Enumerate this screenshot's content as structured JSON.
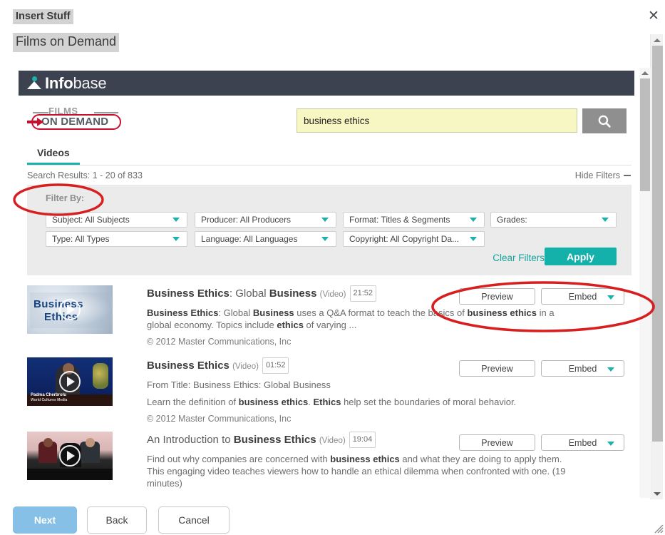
{
  "dialog": {
    "insert_stuff_label": "Insert Stuff",
    "provider_label": "Films on Demand",
    "close_icon": "close-icon"
  },
  "brand": {
    "infobase_bold": "Info",
    "infobase_light": "base",
    "fod_films": "FILMS",
    "fod_ondemand": "ON DEMAND",
    "accent_teal": "#17b3ad",
    "header_dark": "#3c4250",
    "fod_red": "#c8102e"
  },
  "search": {
    "value": "business ethics",
    "placeholder": "Search",
    "button_icon": "search-icon"
  },
  "tabs": [
    {
      "label": "Videos",
      "active": true
    }
  ],
  "results_header": {
    "summary": "Search Results: 1 - 20 of 833",
    "hide_filters": "Hide Filters"
  },
  "filters": {
    "title": "Filter By:",
    "selects": [
      {
        "id": "subject",
        "label": "Subject: All Subjects"
      },
      {
        "id": "producer",
        "label": "Producer: All Producers"
      },
      {
        "id": "format",
        "label": "Format: Titles & Segments"
      },
      {
        "id": "grades",
        "label": "Grades:"
      },
      {
        "id": "type",
        "label": "Type: All Types"
      },
      {
        "id": "language",
        "label": "Language: All Languages"
      },
      {
        "id": "copyright",
        "label": "Copyright: All Copyright Da..."
      }
    ],
    "clear_label": "Clear Filters",
    "apply_label": "Apply"
  },
  "results": [
    {
      "title_html": "<span class=\"b\">Business Ethics</span>: Global <span class=\"b\">Business</span>",
      "media_type": "(Video)",
      "duration": "21:52",
      "from_title": "",
      "description_html": "<b>Business Ethics</b>: Global <b>Business</b> uses a Q&amp;A format to teach the basics of <b>business ethics</b> in a global economy. Topics include <b>ethics</b> of varying ...",
      "copyright": "© 2012 Master Communications, Inc",
      "preview_label": "Preview",
      "embed_label": "Embed",
      "thumb_style": "thumb-1"
    },
    {
      "title_html": "<span class=\"b\">Business Ethics</span>",
      "media_type": "(Video)",
      "duration": "01:52",
      "from_title": "From Title: Business Ethics: Global Business",
      "description_html": "Learn the definition of <b>business ethics</b>. <b>Ethics</b> help set the boundaries of moral behavior.",
      "copyright": "© 2012 Master Communications, Inc",
      "preview_label": "Preview",
      "embed_label": "Embed",
      "thumb_style": "thumb-2",
      "thumb_caption_line1": "Padma Cherbrolu",
      "thumb_caption_line2": "World Cultures Media"
    },
    {
      "title_html": "An Introduction to <span class=\"b\">Business Ethics</span>",
      "media_type": "(Video)",
      "duration": "19:04",
      "from_title": "",
      "description_html": "Find out why companies are concerned with <b>business ethics</b> and what they are doing to apply them. This engaging video teaches viewers how to handle an ethical dilemma when confronted with one. (19 minutes)",
      "copyright": "",
      "preview_label": "Preview",
      "embed_label": "Embed",
      "thumb_style": "thumb-3"
    }
  ],
  "footer": {
    "next_label": "Next",
    "back_label": "Back",
    "cancel_label": "Cancel"
  },
  "annotations": {
    "color": "#d81f20",
    "ellipses": [
      "filter-by-ellipse",
      "preview-embed-ellipse"
    ]
  }
}
